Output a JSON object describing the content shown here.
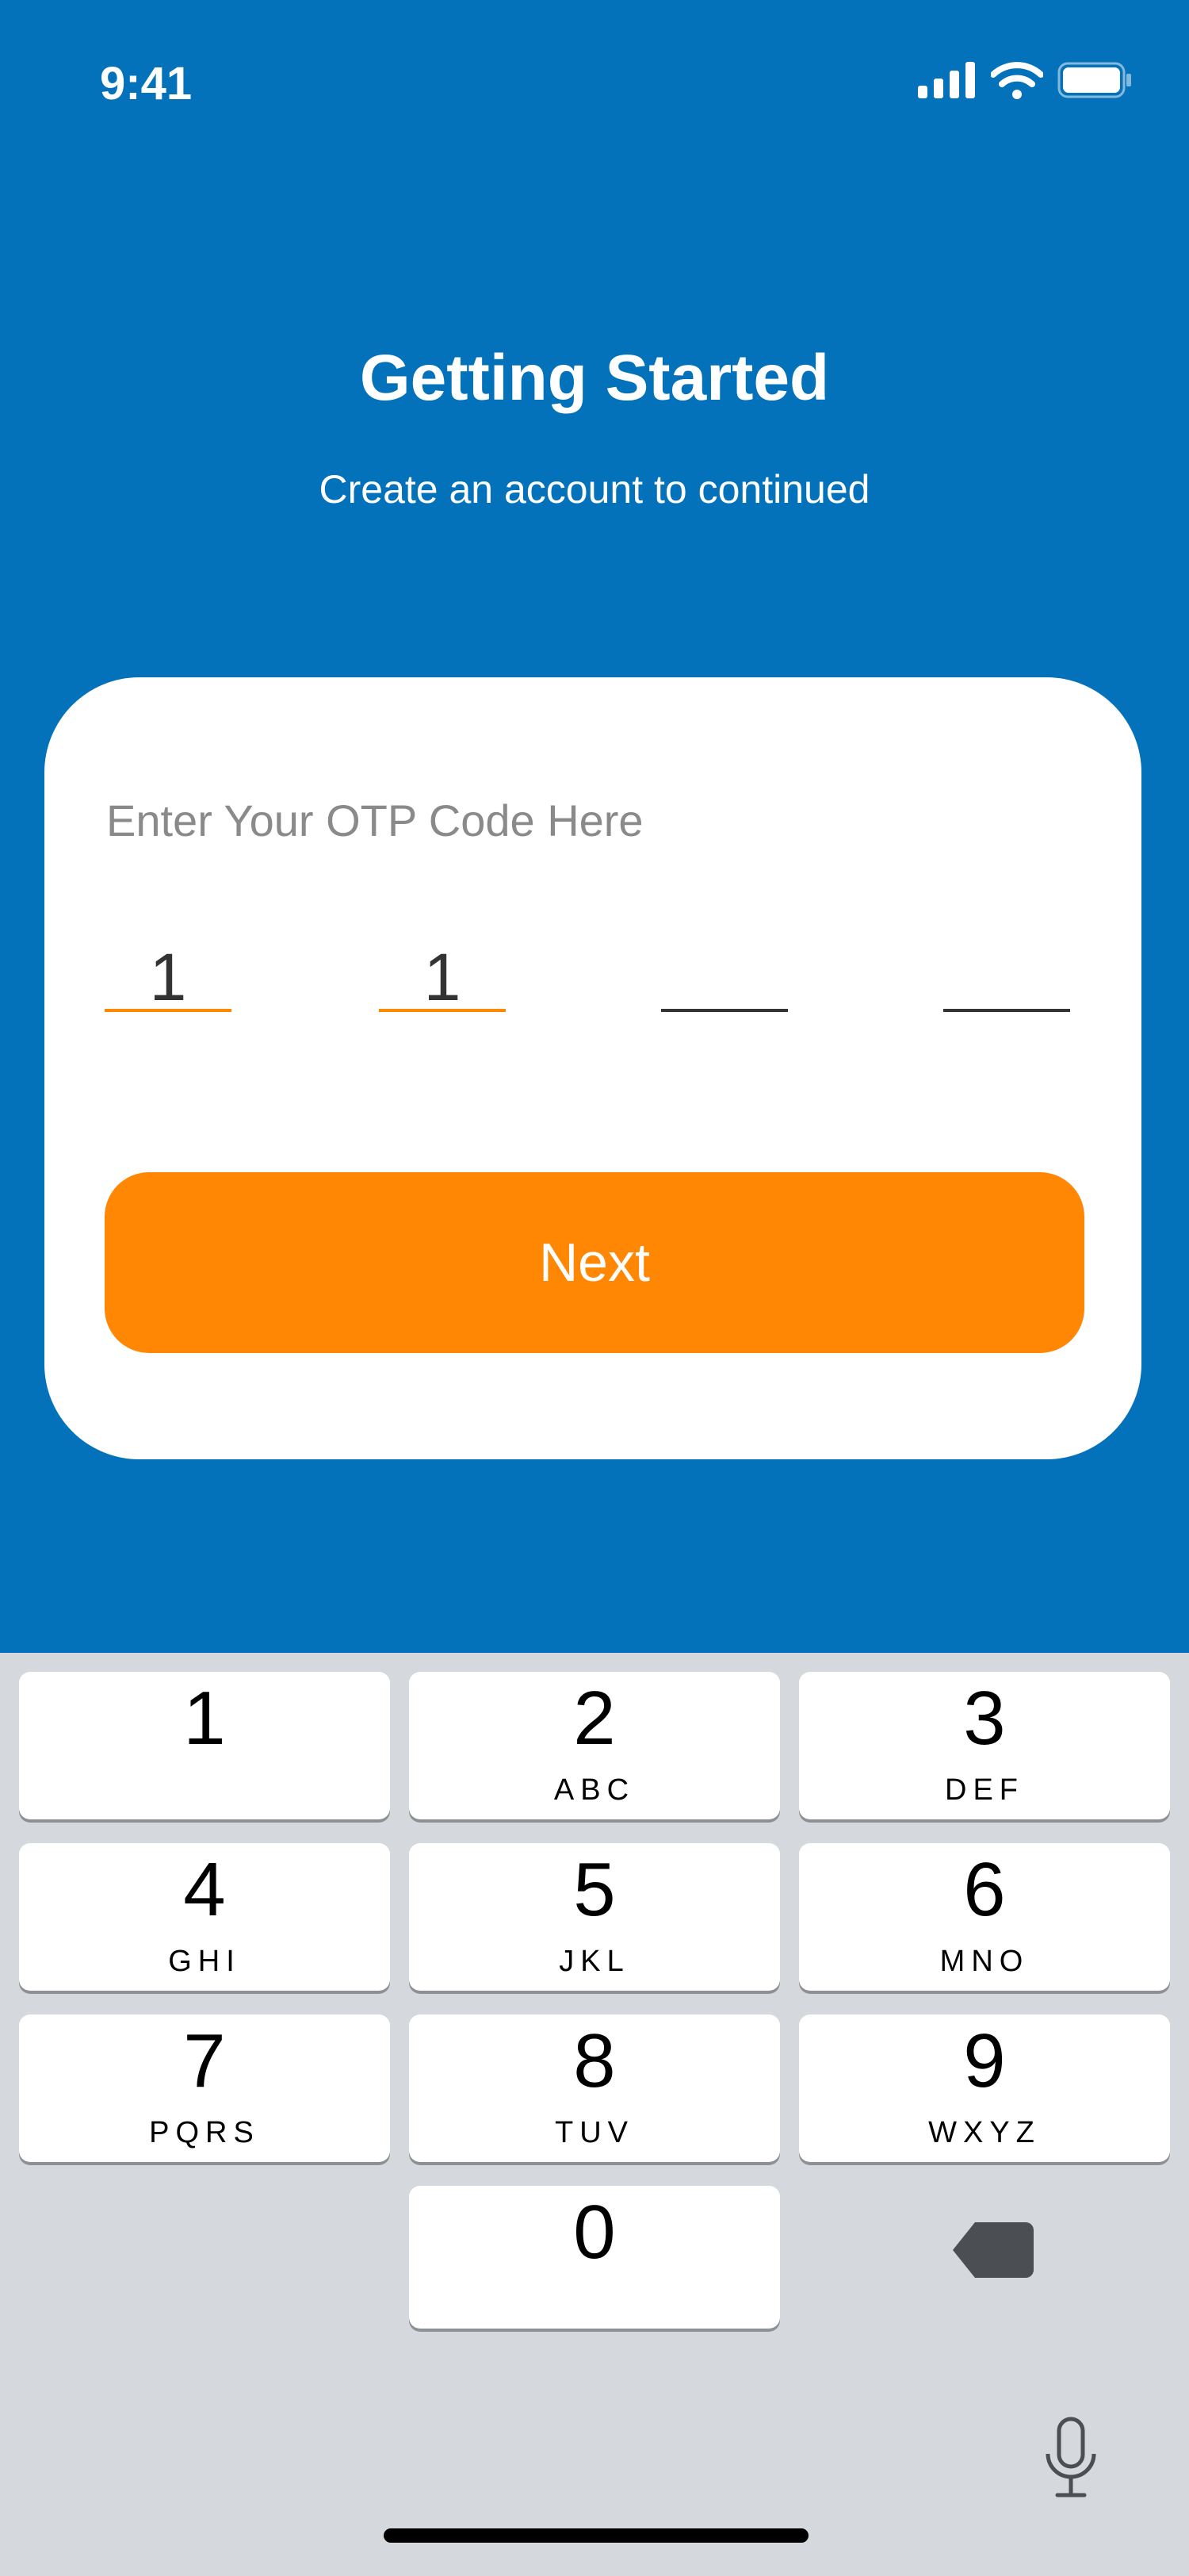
{
  "status_bar": {
    "time": "9:41"
  },
  "header": {
    "title": "Getting Started",
    "subtitle": "Create an account to continued"
  },
  "otp": {
    "prompt": "Enter Your OTP Code Here",
    "digits": [
      "1",
      "1",
      "",
      ""
    ]
  },
  "next_label": "Next",
  "keypad": {
    "keys": [
      {
        "num": "1",
        "letters": ""
      },
      {
        "num": "2",
        "letters": "ABC"
      },
      {
        "num": "3",
        "letters": "DEF"
      },
      {
        "num": "4",
        "letters": "GHI"
      },
      {
        "num": "5",
        "letters": "JKL"
      },
      {
        "num": "6",
        "letters": "MNO"
      },
      {
        "num": "7",
        "letters": "PQRS"
      },
      {
        "num": "8",
        "letters": "TUV"
      },
      {
        "num": "9",
        "letters": "WXYZ"
      },
      {
        "num": "0",
        "letters": ""
      }
    ]
  },
  "colors": {
    "primary": "#0472ba",
    "accent": "#ff8703",
    "keyboard_bg": "#d5d8dd"
  },
  "icons": [
    "cellular-signal-icon",
    "wifi-icon",
    "battery-icon",
    "backspace-icon",
    "microphone-icon"
  ]
}
